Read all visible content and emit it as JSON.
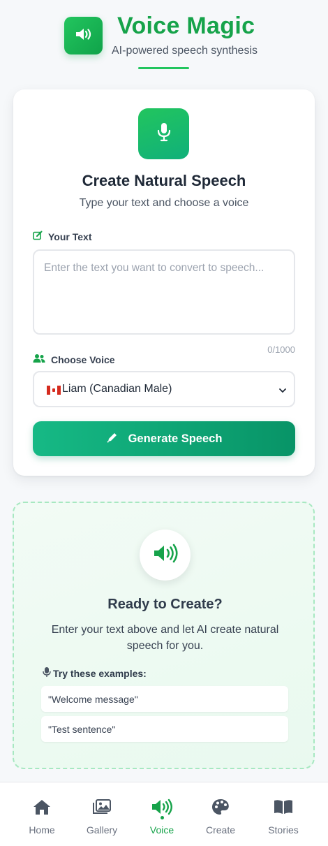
{
  "header": {
    "title": "Voice Magic",
    "subtitle": "AI-powered speech synthesis",
    "logo_icon": "speaker-icon"
  },
  "card": {
    "icon": "microphone-icon",
    "title": "Create Natural Speech",
    "subtitle": "Type your text and choose a voice",
    "text_label": "Your Text",
    "text_placeholder": "Enter the text you want to convert to speech...",
    "text_value": "",
    "char_count": "0/1000",
    "voice_label": "Choose Voice",
    "voice_selected": "Liam (Canadian Male)",
    "voice_flag": "canada-flag",
    "generate_button": "Generate Speech"
  },
  "ready": {
    "icon": "speaker-icon",
    "title": "Ready to Create?",
    "text": "Enter your text above and let AI create natural speech for you.",
    "examples_label": "Try these examples:",
    "examples_icon": "microphone-icon",
    "examples": [
      "\"Welcome message\"",
      "\"Test sentence\""
    ]
  },
  "nav": {
    "items": [
      {
        "label": "Home",
        "icon": "home-icon"
      },
      {
        "label": "Gallery",
        "icon": "gallery-icon"
      },
      {
        "label": "Voice",
        "icon": "speaker-icon",
        "active": true
      },
      {
        "label": "Create",
        "icon": "palette-icon"
      },
      {
        "label": "Stories",
        "icon": "book-icon"
      }
    ]
  },
  "colors": {
    "accent": "#16a34a",
    "button_start": "#16b985",
    "button_end": "#089467",
    "panel_bg": "#eefbf3",
    "panel_border": "#a7e8c1"
  }
}
